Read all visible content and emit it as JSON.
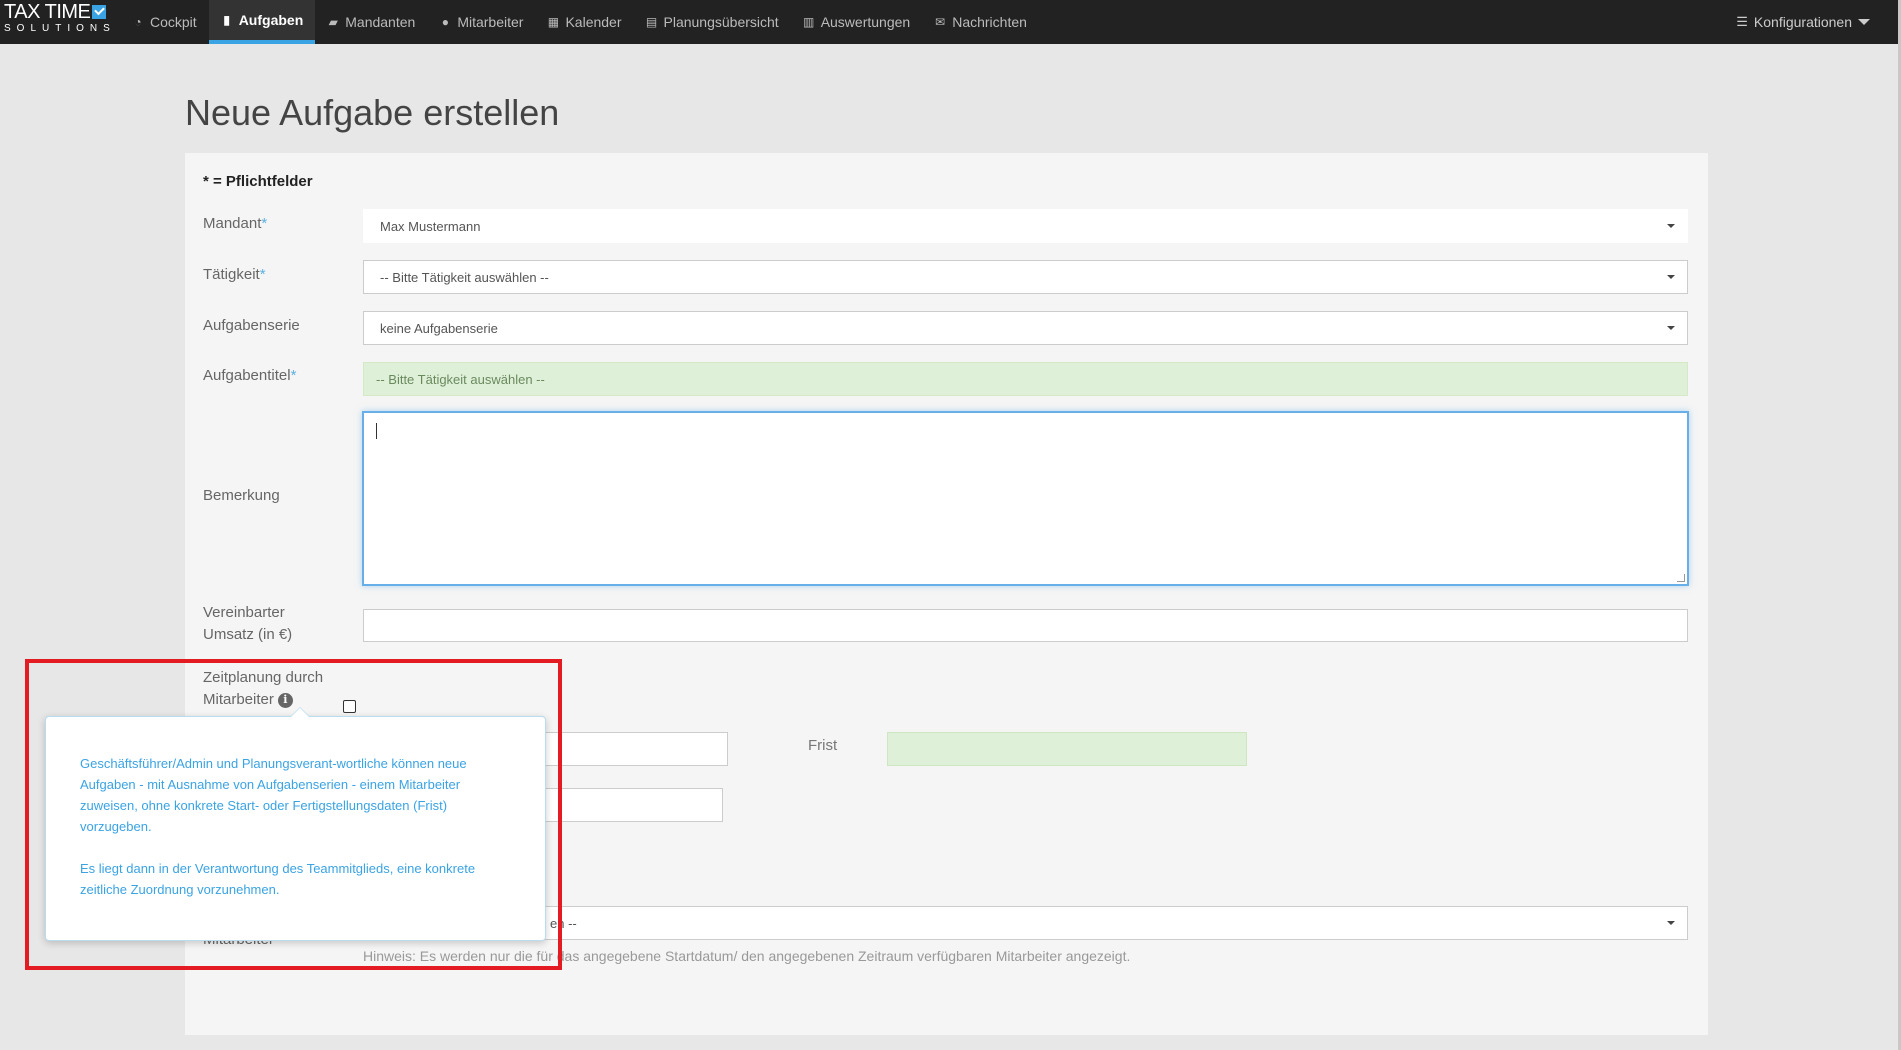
{
  "logo": {
    "line1": "TAX TIME",
    "line2": "SOLUTIONS"
  },
  "nav": {
    "items": [
      {
        "label": "Cockpit",
        "icon": "gauge-icon",
        "glyph": "◔"
      },
      {
        "label": "Aufgaben",
        "icon": "bookmark-icon",
        "glyph": "▮",
        "active": true
      },
      {
        "label": "Mandanten",
        "icon": "folder-icon",
        "glyph": "▰"
      },
      {
        "label": "Mitarbeiter",
        "icon": "users-icon",
        "glyph": "●"
      },
      {
        "label": "Kalender",
        "icon": "calendar-icon",
        "glyph": "▦"
      },
      {
        "label": "Planungsübersicht",
        "icon": "document-icon",
        "glyph": "▤"
      },
      {
        "label": "Auswertungen",
        "icon": "bar-chart-icon",
        "glyph": "▥"
      },
      {
        "label": "Nachrichten",
        "icon": "envelope-icon",
        "glyph": "✉"
      }
    ],
    "config_label": "Konfigurationen"
  },
  "page": {
    "title": "Neue Aufgabe erstellen"
  },
  "form": {
    "required_note": "* = Pflichtfelder",
    "mandant": {
      "label": "Mandant",
      "value": "Max Mustermann"
    },
    "taetigkeit": {
      "label": "Tätigkeit",
      "value": "-- Bitte Tätigkeit auswählen --"
    },
    "aufgabenserie": {
      "label": "Aufgabenserie",
      "value": "keine Aufgabenserie"
    },
    "aufgabentitel": {
      "label": "Aufgabentitel",
      "value": "-- Bitte Tätigkeit auswählen --"
    },
    "bemerkung": {
      "label": "Bemerkung",
      "value": ""
    },
    "umsatz": {
      "label_line1": "Vereinbarter",
      "label_line2": "Umsatz (in €)",
      "value": ""
    },
    "zeitplanung": {
      "label_line1": "Zeitplanung durch",
      "label_line2": "Mitarbeiter",
      "checked": false
    },
    "frist": {
      "label": "Frist"
    },
    "mitarbeiter": {
      "label": "Mitarbeiter",
      "select_fragment": "en --"
    },
    "hint": "Hinweis: Es werden nur die für das angegebene Startdatum/ den angegebenen Zeitraum verfügbaren Mitarbeiter angezeigt."
  },
  "tooltip": {
    "paragraph1": "Geschäftsführer/Admin und Planungsverant-wortliche können neue Aufgaben - mit Ausnahme von Aufgabenserien - einem Mitarbeiter zuweisen, ohne konkrete Start- oder Fertigstellungsdaten (Frist) vorzugeben.",
    "paragraph2": "Es liegt dann in der Verantwortung des Teammitglieds, eine konkrete zeitliche Zuordnung vorzunehmen."
  },
  "colors": {
    "accent": "#3aa3e3",
    "highlight": "#e31b23",
    "nav_bg": "#222222",
    "success_bg": "#dff0d8"
  }
}
